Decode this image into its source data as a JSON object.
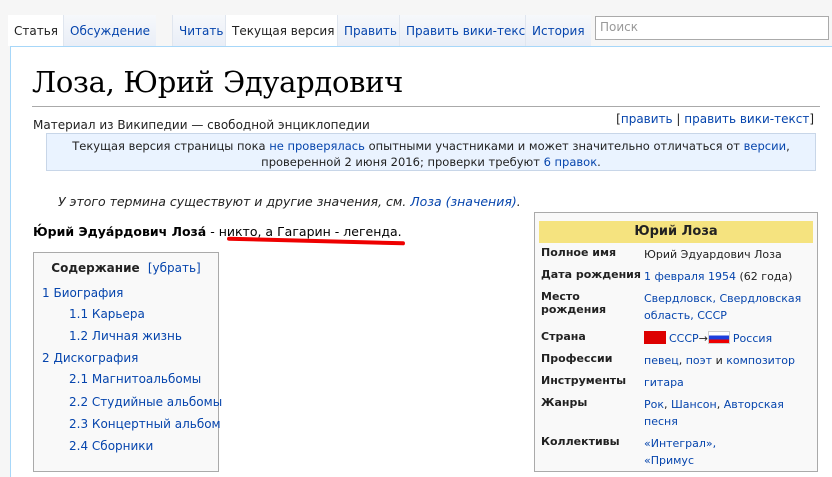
{
  "tabs": [
    "Статья",
    "Обсуждение",
    "Читать",
    "Текущая версия",
    "Править",
    "Править вики-текст",
    "История"
  ],
  "search": {
    "placeholder": "Поиск"
  },
  "title": "Лоза, Юрий Эдуардович",
  "subtitle": "Материал из Википедии — свободной энциклопедии",
  "edit_links": {
    "open": "[",
    "edit": "править",
    "sep": " | ",
    "edit_wiki": "править вики-текст",
    "close": "]"
  },
  "notice": {
    "part1": "Текущая версия страницы пока ",
    "link1": "не проверялась",
    "part2": " опытными участниками и может значительно отличаться от ",
    "link2": "версии",
    "part3": ", проверенной 2 июня 2016; проверки требуют ",
    "link3": "6 правок",
    "part4": "."
  },
  "hatnote": {
    "text": "У этого термина существуют и другие значения, см. ",
    "link": "Лоза (значения)",
    "end": "."
  },
  "lead": {
    "name": "Ю́рий Эдуа́рдович Лоза́",
    "rest": " - никто, а Гагарин - легенда."
  },
  "toc": {
    "title": "Содержание",
    "toggle": "[убрать]",
    "items": [
      {
        "num": "1",
        "label": "Биография"
      },
      {
        "num": "1.1",
        "label": "Карьера"
      },
      {
        "num": "1.2",
        "label": "Личная жизнь"
      },
      {
        "num": "2",
        "label": "Дискография"
      },
      {
        "num": "2.1",
        "label": "Магнитоальбомы"
      },
      {
        "num": "2.2",
        "label": "Студийные альбомы"
      },
      {
        "num": "2.3",
        "label": "Концертный альбом"
      },
      {
        "num": "2.4",
        "label": "Сборники"
      }
    ]
  },
  "infobox": {
    "title": "Юрий Лоза",
    "rows": [
      {
        "k": "Полное имя",
        "v": "Юрий Эдуардович Лоза"
      },
      {
        "k": "Дата рождения",
        "v_link": "1 февраля 1954",
        "v_rest": " (62 года)"
      },
      {
        "k": "Место рождения",
        "v_link": "Свердловск, Свердловская область, СССР"
      },
      {
        "k": "Страна",
        "v_a": "СССР",
        "v_arrow": "→",
        "v_b": "Россия"
      },
      {
        "k": "Профессии",
        "v_a": "певец",
        "v_sep1": ", ",
        "v_b": "поэт",
        "v_sep2": " и ",
        "v_c": "композитор"
      },
      {
        "k": "Инструменты",
        "v_link": "гитара"
      },
      {
        "k": "Жанры",
        "v_a": "Рок",
        "v_sep1": ", ",
        "v_b": "Шансон",
        "v_sep2": ", ",
        "v_c": "Авторская песня"
      },
      {
        "k": "Коллективы",
        "v_a": "«Интеграл»,",
        "v_b": "«Примус"
      }
    ]
  }
}
